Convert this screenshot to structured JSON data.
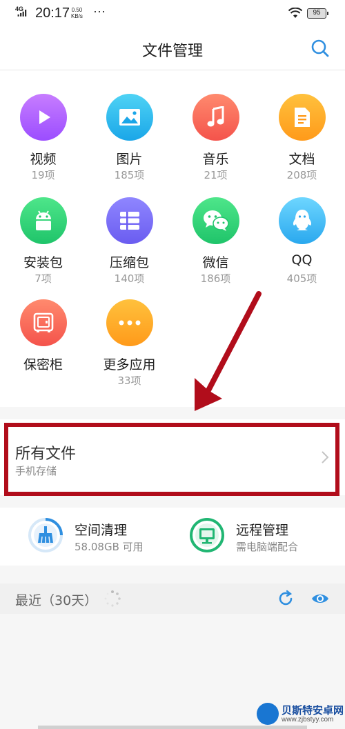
{
  "status_bar": {
    "network": "4G",
    "time": "20:17",
    "speed_value": "0.50",
    "speed_unit": "KB/s",
    "dots": "···",
    "battery": "95"
  },
  "header": {
    "title": "文件管理",
    "search_icon": "search-icon"
  },
  "categories": [
    {
      "name": "视频",
      "count": "19项",
      "icon": "play-icon",
      "color_top": "#c77dff",
      "color_bottom": "#9b4dff"
    },
    {
      "name": "图片",
      "count": "185项",
      "icon": "image-icon",
      "color_top": "#4fd3f5",
      "color_bottom": "#1aa6e8"
    },
    {
      "name": "音乐",
      "count": "21项",
      "icon": "music-note-icon",
      "color_top": "#ff8a6e",
      "color_bottom": "#f4534b"
    },
    {
      "name": "文档",
      "count": "208项",
      "icon": "document-icon",
      "color_top": "#ffc13d",
      "color_bottom": "#ff9a1a"
    },
    {
      "name": "安装包",
      "count": "7项",
      "icon": "android-icon",
      "color_top": "#4ee68a",
      "color_bottom": "#1fc46a"
    },
    {
      "name": "压缩包",
      "count": "140项",
      "icon": "archive-icon",
      "color_top": "#8f86ff",
      "color_bottom": "#6a5cf0"
    },
    {
      "name": "微信",
      "count": "186项",
      "icon": "wechat-icon",
      "color_top": "#4ee68a",
      "color_bottom": "#1fc46a"
    },
    {
      "name": "QQ",
      "count": "405项",
      "icon": "qq-penguin-icon",
      "color_top": "#6ed6ff",
      "color_bottom": "#2aa8ee"
    },
    {
      "name": "保密柜",
      "count": "",
      "icon": "safe-icon",
      "color_top": "#ff8a6e",
      "color_bottom": "#f4534b"
    },
    {
      "name": "更多应用",
      "count": "33项",
      "icon": "more-dots-icon",
      "color_top": "#ffc13d",
      "color_bottom": "#ff9a1a"
    }
  ],
  "all_files": {
    "title": "所有文件",
    "subtitle": "手机存储"
  },
  "tools": [
    {
      "title": "空间清理",
      "subtitle": "58.08GB 可用",
      "icon": "broom-icon",
      "color": "#2f8fe0"
    },
    {
      "title": "远程管理",
      "subtitle": "需电脑端配合",
      "icon": "monitor-icon",
      "color": "#21b673"
    }
  ],
  "recent": {
    "title": "最近（30天）"
  },
  "watermark": {
    "name": "贝斯特安卓网",
    "url": "www.zjbstyy.com"
  },
  "colors": {
    "accent": "#2f8fe0",
    "highlight": "#b10d1b"
  }
}
